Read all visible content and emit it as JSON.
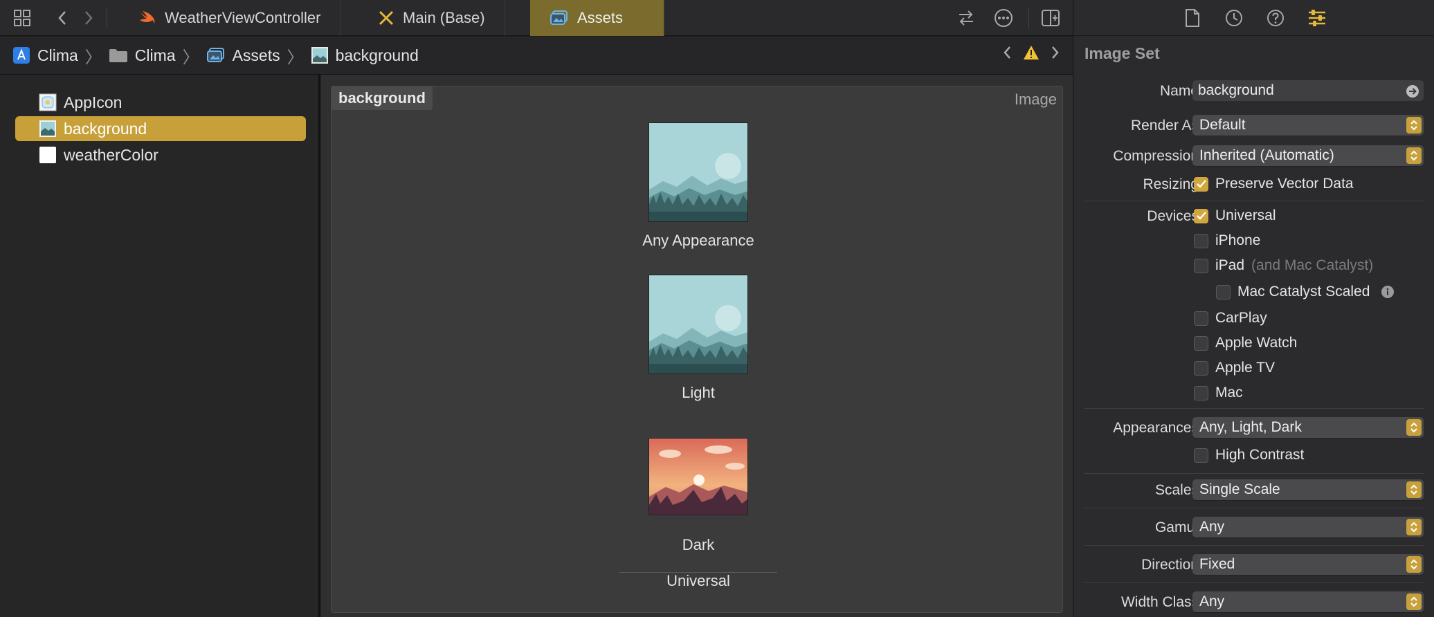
{
  "tabs": [
    {
      "label": "WeatherViewController",
      "icon": "swift-icon"
    },
    {
      "label": "Main (Base)",
      "icon": "storyboard-icon"
    },
    {
      "label": "Assets",
      "icon": "asset-catalog-icon",
      "active": true
    }
  ],
  "breadcrumb": [
    "Clima",
    "Clima",
    "Assets",
    "background"
  ],
  "navigator": {
    "items": [
      {
        "label": "AppIcon",
        "icon": "app-icon-set-icon"
      },
      {
        "label": "background",
        "icon": "image-set-icon",
        "selected": true
      },
      {
        "label": "weatherColor",
        "icon": "color-set-icon"
      }
    ]
  },
  "editor": {
    "set_name": "background",
    "set_kind": "Image",
    "slots": [
      "Any Appearance",
      "Light",
      "Dark"
    ],
    "group_label": "Universal"
  },
  "inspector": {
    "title": "Image Set",
    "name_label": "Name",
    "name_value": "background",
    "render_as_label": "Render As",
    "render_as_value": "Default",
    "compression_label": "Compression",
    "compression_value": "Inherited (Automatic)",
    "resizing_label": "Resizing",
    "resizing_option": "Preserve Vector Data",
    "devices_label": "Devices",
    "devices": {
      "universal": "Universal",
      "iphone": "iPhone",
      "ipad": "iPad",
      "ipad_note": "(and Mac Catalyst)",
      "mac_catalyst_scaled": "Mac Catalyst Scaled",
      "carplay": "CarPlay",
      "apple_watch": "Apple Watch",
      "apple_tv": "Apple TV",
      "mac": "Mac"
    },
    "appearances_label": "Appearances",
    "appearances_value": "Any, Light, Dark",
    "high_contrast": "High Contrast",
    "scales_label": "Scales",
    "scales_value": "Single Scale",
    "gamut_label": "Gamut",
    "gamut_value": "Any",
    "direction_label": "Direction",
    "direction_value": "Fixed",
    "width_class_label": "Width Class",
    "width_class_value": "Any"
  },
  "colors": {
    "accent": "#d2a63f",
    "active_tab": "#7b6b2c",
    "selection": "#c8a03a"
  }
}
